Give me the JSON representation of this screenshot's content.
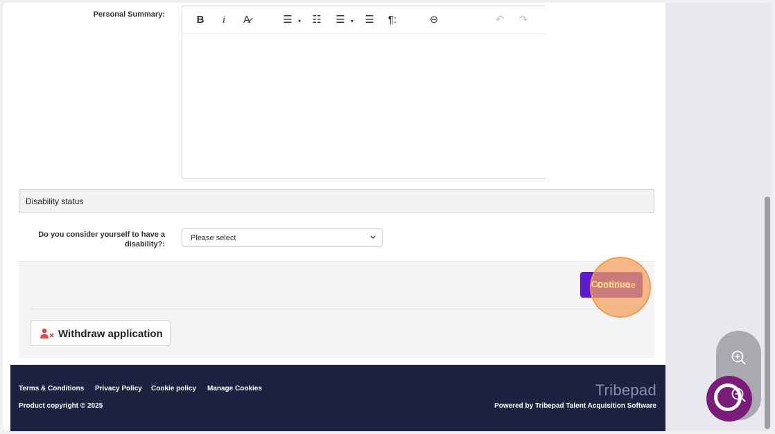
{
  "form": {
    "personal_summary_label": "Personal Summary:",
    "editor_toolbar": {
      "bold": "B",
      "italic": "i",
      "clear_format": "A̷",
      "bullet_list": "☰",
      "dropdown_arrow": "▾",
      "numbered_list": "☷",
      "checklist": "☰",
      "align": "☰",
      "paragraph": "¶:",
      "link": "⊖",
      "undo": "↶",
      "redo": "↷"
    },
    "disability_section_title": "Disability status",
    "disability_question": "Do you consider yourself to have a disability?:",
    "disability_select": {
      "selected": "Please select"
    }
  },
  "actions": {
    "continue_label": "Continue",
    "withdraw_label": "Withdraw application"
  },
  "footer": {
    "links": [
      "Terms & Conditions",
      "Privacy Policy",
      "Cookie policy",
      "Manage Cookies"
    ],
    "copyright": "Product copyright © 2025",
    "brand": "Tribepad",
    "powered_by": "Powered by Tribepad Talent Acquisition Software"
  },
  "colors": {
    "primary": "#5c1bd2",
    "footer_bg": "#1b2340",
    "highlight": "#f79f5a",
    "withdraw_icon": "#e04a4a",
    "chat": "#7a1d7a"
  },
  "icons": {
    "withdraw": "user-remove-icon",
    "zoom_in": "zoom-in-icon",
    "zoom_out": "zoom-out-icon",
    "chat": "chat-icon"
  }
}
